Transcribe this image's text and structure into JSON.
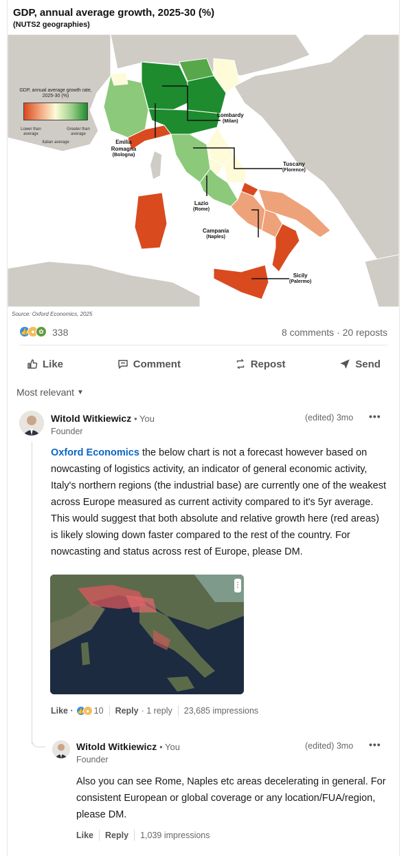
{
  "post_image": {
    "title": "GDP, annual average growth, 2025-30 (%)",
    "subtitle": "(NUTS2 geographies)",
    "source": "Source: Oxford Economics, 2025",
    "legend": {
      "title": "GDP, annual average growth rate, 2025-30 (%)",
      "low": "Lower than average",
      "high": "Greater than average",
      "mid": "Italian average"
    },
    "labels": [
      {
        "region": "Lombardy",
        "city": "(Milan)"
      },
      {
        "region": "Emilia Romagna",
        "city": "(Bologna)"
      },
      {
        "region": "Tuscany",
        "city": "(Florence)"
      },
      {
        "region": "Lazio",
        "city": "(Rome)"
      },
      {
        "region": "Campania",
        "city": "(Naples)"
      },
      {
        "region": "Sicily",
        "city": "(Palermo)"
      }
    ],
    "colors": {
      "strong_green": "#1e8b2e",
      "light_green": "#8cc97a",
      "pale_yellow": "#fdfbd8",
      "light_orange": "#eea27a",
      "red_orange": "#d94a1e",
      "land": "#cfcbc5",
      "sea": "#ffffff"
    }
  },
  "social": {
    "reaction_count": "338",
    "comment_stats": "8 comments · 20 reposts",
    "reaction_icons": [
      "like-icon",
      "insight-icon",
      "celebrate-icon"
    ]
  },
  "actions": {
    "like": "Like",
    "comment": "Comment",
    "repost": "Repost",
    "send": "Send"
  },
  "sort": {
    "label": "Most relevant"
  },
  "comments": [
    {
      "author": "Witold Witkiewicz",
      "you": "• You",
      "role": "Founder",
      "time": "(edited) 3mo",
      "mention": "Oxford Economics",
      "text": " the below chart is not a forecast however based on nowcasting of logistics activity, an indicator of general economic activity, Italy's northern regions (the industrial base) are currently one of the weakest across Europe measured as current activity compared to it's 5yr average. This would suggest that both absolute and relative growth here (red areas) is likely slowing down faster compared to the rest of the country. For nowcasting and status across rest of Europe, please DM.",
      "like": "Like ·",
      "reactions": "10",
      "reply": "Reply",
      "replies": "· 1 reply",
      "impressions": "23,685 impressions"
    },
    {
      "author": "Witold Witkiewicz",
      "you": "• You",
      "role": "Founder",
      "time": "(edited) 3mo",
      "text": "Also you can see Rome, Naples etc areas decelerating in general. For consistent European or global coverage or any location/FUA/region, please DM.",
      "like": "Like",
      "reply": "Reply",
      "impressions": "1,039 impressions"
    }
  ]
}
